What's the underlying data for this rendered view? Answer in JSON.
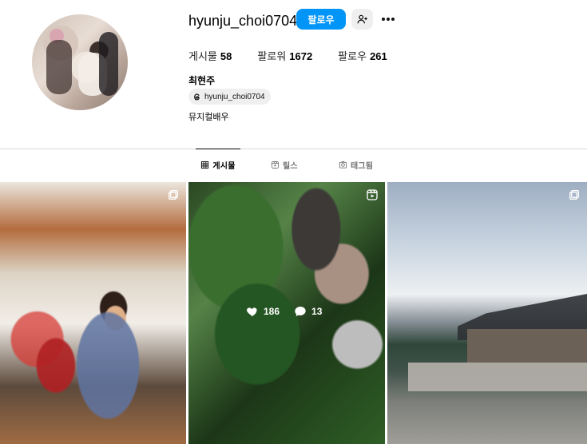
{
  "profile": {
    "username": "hyunju_choi0704",
    "full_name": "최현주",
    "bio": "뮤지컬배우",
    "threads_handle": "hyunju_choi0704"
  },
  "actions": {
    "follow_label": "팔로우",
    "suggest_icon": "person-add-icon",
    "more_icon": "more-icon"
  },
  "stats": [
    {
      "label": "게시물",
      "value": "58"
    },
    {
      "label": "팔로워",
      "value": "1672"
    },
    {
      "label": "팔로우",
      "value": "261"
    }
  ],
  "tabs": [
    {
      "label": "게시물",
      "icon": "grid-icon",
      "active": true
    },
    {
      "label": "릴스",
      "icon": "reels-icon",
      "active": false
    },
    {
      "label": "태그됨",
      "icon": "tagged-icon",
      "active": false
    }
  ],
  "posts": [
    {
      "type": "carousel",
      "icon": "carousel-icon"
    },
    {
      "type": "reel",
      "icon": "reel-icon",
      "likes": "186",
      "comments": "13"
    },
    {
      "type": "carousel",
      "icon": "carousel-icon"
    }
  ],
  "colors": {
    "accent": "#0095f6",
    "muted_button": "#efefef",
    "text": "#000000",
    "secondary_text": "#737373",
    "divider": "#dbdbdb"
  }
}
